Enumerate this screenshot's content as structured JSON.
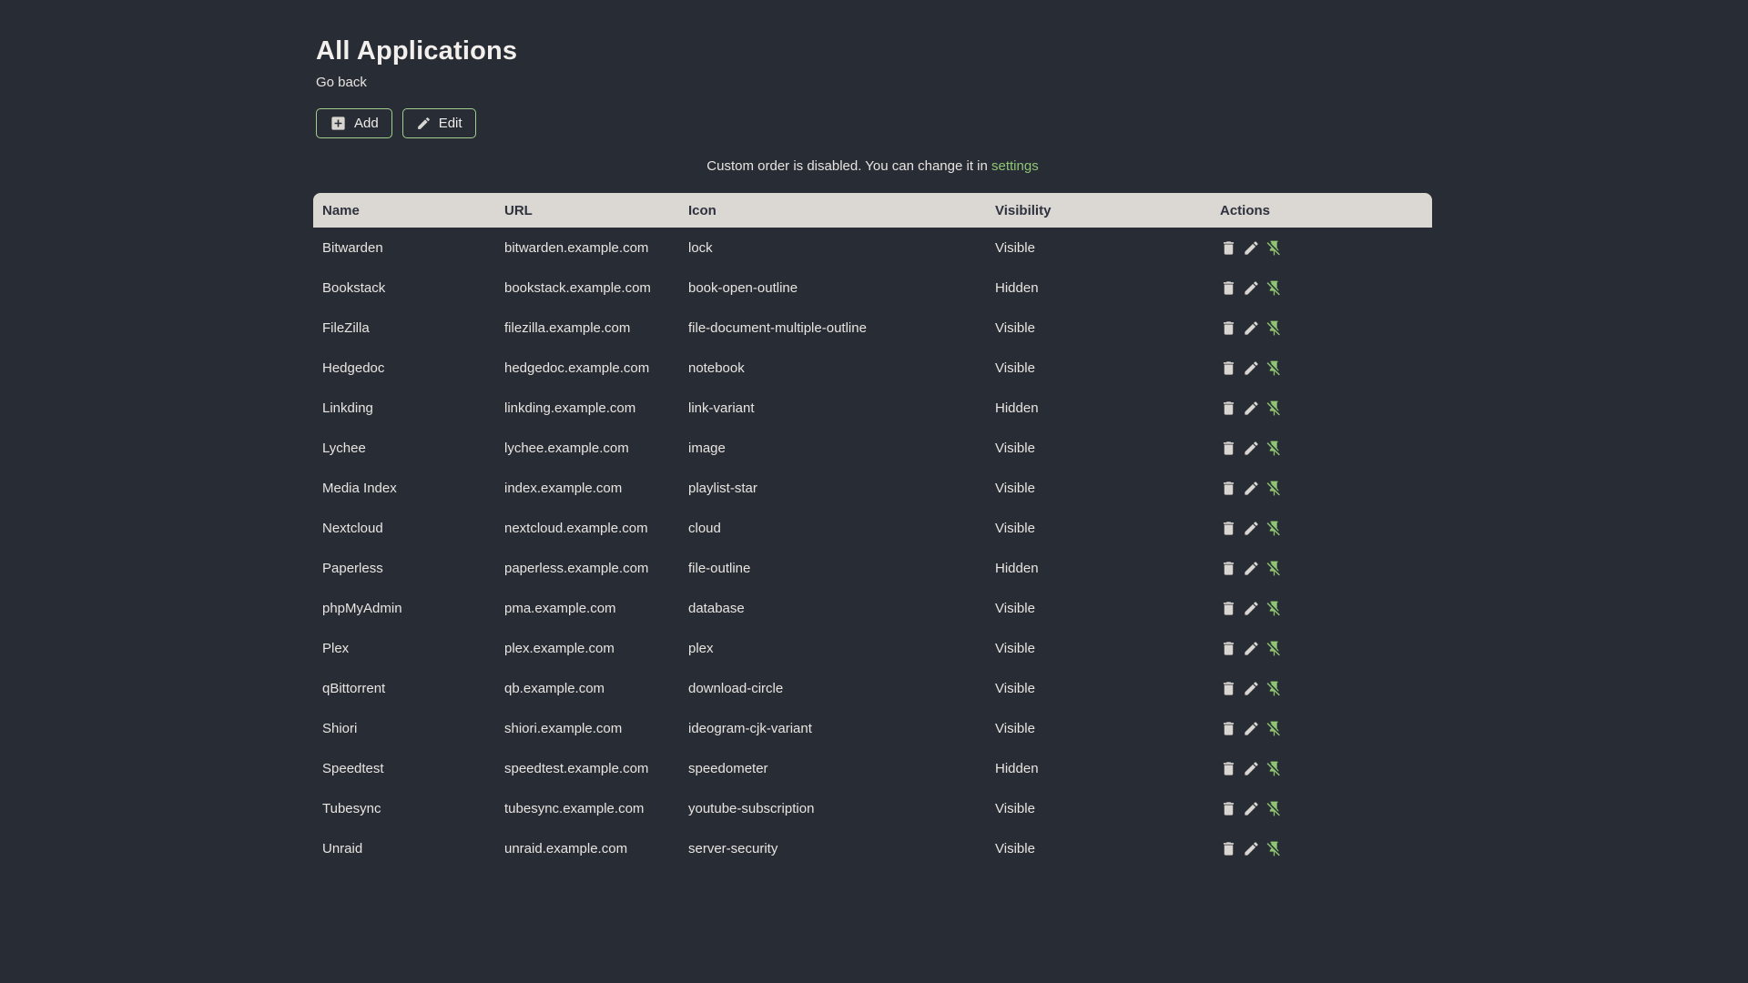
{
  "page": {
    "title": "All Applications",
    "back_link_label": "Go back",
    "notice_text": "Custom order is disabled. You can change it in",
    "notice_link_label": "settings"
  },
  "toolbar": {
    "add_label": "Add",
    "edit_label": "Edit",
    "add_icon": "plus-box-icon",
    "edit_icon": "pencil-icon"
  },
  "table": {
    "headers": [
      "Name",
      "URL",
      "Icon",
      "Visibility",
      "Actions"
    ],
    "row_actions": [
      "delete-icon",
      "pencil-icon",
      "pin-off-icon"
    ],
    "rows": [
      {
        "name": "Bitwarden",
        "url": "bitwarden.example.com",
        "icon": "lock",
        "visibility": "Visible"
      },
      {
        "name": "Bookstack",
        "url": "bookstack.example.com",
        "icon": "book-open-outline",
        "visibility": "Hidden"
      },
      {
        "name": "FileZilla",
        "url": "filezilla.example.com",
        "icon": "file-document-multiple-outline",
        "visibility": "Visible"
      },
      {
        "name": "Hedgedoc",
        "url": "hedgedoc.example.com",
        "icon": "notebook",
        "visibility": "Visible"
      },
      {
        "name": "Linkding",
        "url": "linkding.example.com",
        "icon": "link-variant",
        "visibility": "Hidden"
      },
      {
        "name": "Lychee",
        "url": "lychee.example.com",
        "icon": "image",
        "visibility": "Visible"
      },
      {
        "name": "Media Index",
        "url": "index.example.com",
        "icon": "playlist-star",
        "visibility": "Visible"
      },
      {
        "name": "Nextcloud",
        "url": "nextcloud.example.com",
        "icon": "cloud",
        "visibility": "Visible"
      },
      {
        "name": "Paperless",
        "url": "paperless.example.com",
        "icon": "file-outline",
        "visibility": "Hidden"
      },
      {
        "name": "phpMyAdmin",
        "url": "pma.example.com",
        "icon": "database",
        "visibility": "Visible"
      },
      {
        "name": "Plex",
        "url": "plex.example.com",
        "icon": "plex",
        "visibility": "Visible"
      },
      {
        "name": "qBittorrent",
        "url": "qb.example.com",
        "icon": "download-circle",
        "visibility": "Visible"
      },
      {
        "name": "Shiori",
        "url": "shiori.example.com",
        "icon": "ideogram-cjk-variant",
        "visibility": "Visible"
      },
      {
        "name": "Speedtest",
        "url": "speedtest.example.com",
        "icon": "speedometer",
        "visibility": "Hidden"
      },
      {
        "name": "Tubesync",
        "url": "tubesync.example.com",
        "icon": "youtube-subscription",
        "visibility": "Visible"
      },
      {
        "name": "Unraid",
        "url": "unraid.example.com",
        "icon": "server-security",
        "visibility": "Visible"
      }
    ]
  },
  "colors": {
    "page_bg": "#282c35",
    "header_bg": "#dbd7d2",
    "header_text": "#2d323e",
    "body_text": "#e8e5e1",
    "accent_green": "#8fc573",
    "button_border_green": "#a2cf8e",
    "icon_light": "#d9d6d1"
  }
}
